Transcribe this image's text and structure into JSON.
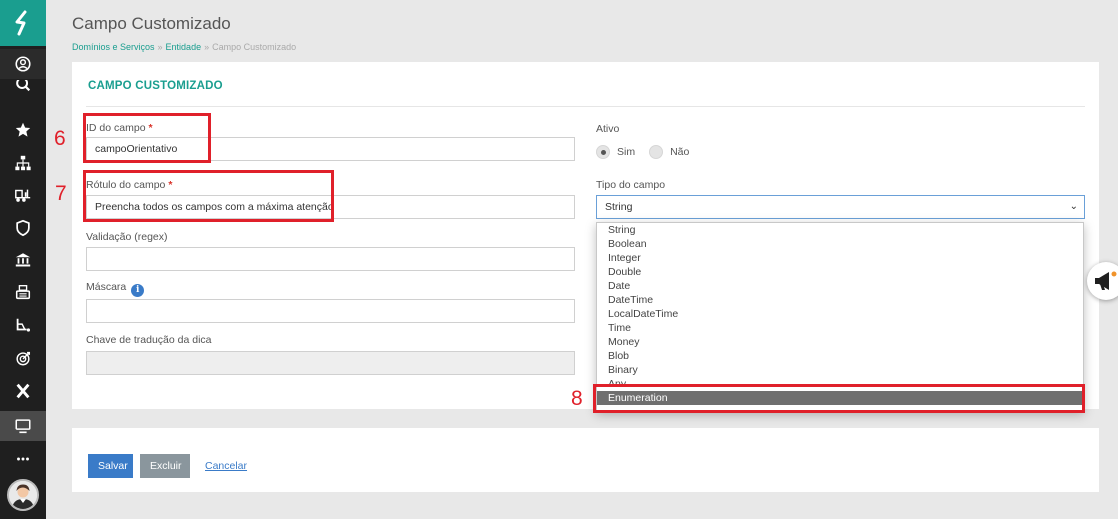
{
  "header": {
    "title": "Campo Customizado",
    "breadcrumb": [
      "Domínios e Serviços",
      "Entidade",
      "Campo Customizado"
    ]
  },
  "form": {
    "section_title": "CAMPO CUSTOMIZADO",
    "id_label": "ID do campo",
    "required_marker": "*",
    "id_value": "campoOrientativo",
    "rotulo_label": "Rótulo do campo",
    "rotulo_value": "Preencha todos os campos com a máxima atenção",
    "validacao_label": "Validação (regex)",
    "validacao_value": "",
    "mascara_label": "Máscara",
    "mascara_value": "",
    "chave_label": "Chave de tradução da dica",
    "chave_value": "",
    "ativo_label": "Ativo",
    "ativo_options": [
      "Sim",
      "Não"
    ],
    "ativo_selected": "Sim",
    "tipo_label": "Tipo do campo",
    "tipo_value": "String",
    "tipo_options": [
      "String",
      "Boolean",
      "Integer",
      "Double",
      "Date",
      "DateTime",
      "LocalDateTime",
      "Time",
      "Money",
      "Blob",
      "Binary",
      "Any",
      "Enumeration"
    ],
    "tipo_highlighted": "Enumeration"
  },
  "actions": {
    "save_label": "Salvar",
    "delete_label": "Excluir",
    "cancel_label": "Cancelar"
  },
  "annotations": [
    "6",
    "7",
    "8"
  ],
  "colors": {
    "accent": "#1a9e8f",
    "primary_button": "#3a7bc8",
    "annotation": "#e0202a",
    "sidebar": "#1f1f1f"
  },
  "sidebar_icons": [
    "logo-icon",
    "user-circle-icon",
    "search-icon",
    "star-icon",
    "hierarchy-icon",
    "forklift-icon",
    "shield-icon",
    "bank-icon",
    "cash-register-icon",
    "scale-icon",
    "target-icon",
    "x-icon",
    "monitor-icon",
    "more-icon"
  ]
}
